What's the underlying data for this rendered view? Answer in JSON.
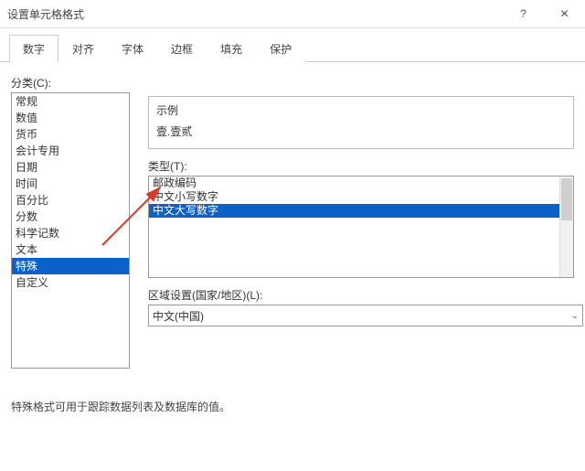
{
  "window": {
    "title": "设置单元格格式"
  },
  "tabs": {
    "tab1": "数字",
    "tab2": "对齐",
    "tab3": "字体",
    "tab4": "边框",
    "tab5": "填充",
    "tab6": "保护"
  },
  "category_label": "分类(C):",
  "categories": [
    "常规",
    "数值",
    "货币",
    "会计专用",
    "日期",
    "时间",
    "百分比",
    "分数",
    "科学记数",
    "文本",
    "特殊",
    "自定义"
  ],
  "category_selected_index": 10,
  "example": {
    "label": "示例",
    "value": "壹.壹贰"
  },
  "type_label": "类型(T):",
  "types": [
    "邮政编码",
    "中文小写数字",
    "中文大写数字"
  ],
  "type_selected_index": 2,
  "locale_label": "区域设置(国家/地区)(L):",
  "locale_value": "中文(中国)",
  "description": "特殊格式可用于跟踪数据列表及数据库的值。",
  "icons": {
    "help": "?",
    "close": "✕",
    "chevron_down": "⌄"
  }
}
